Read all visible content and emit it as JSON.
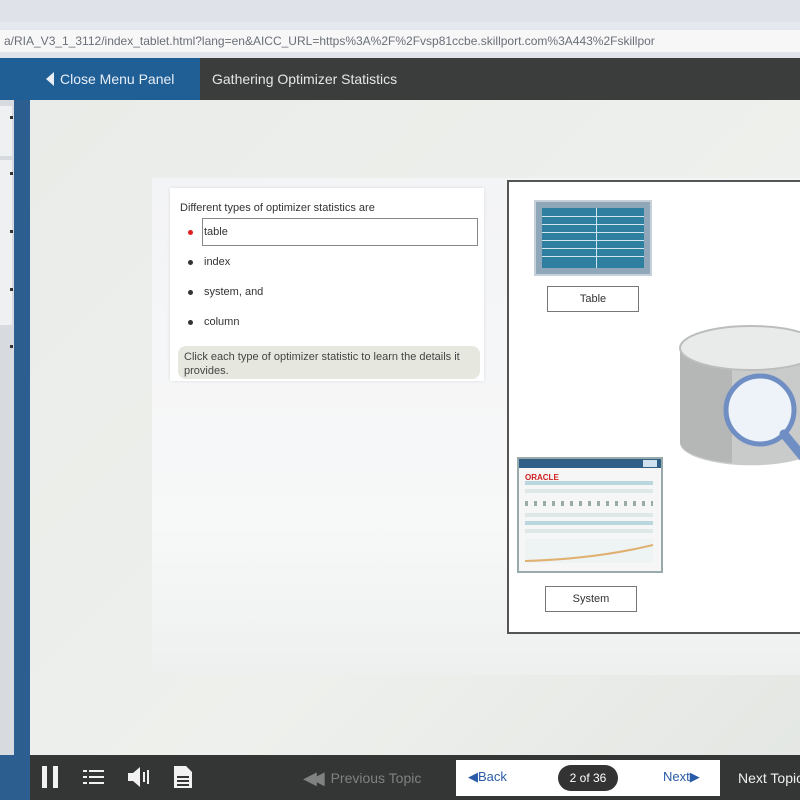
{
  "browser": {
    "url": "a/RIA_V3_1_3112/index_tablet.html?lang=en&AICC_URL=https%3A%2F%2Fvsp81ccbe.skillport.com%3A443%2Fskillpor"
  },
  "header": {
    "close_menu_label": "Close Menu Panel",
    "course_title": "Gathering Optimizer Statistics"
  },
  "lesson": {
    "intro": "Different types of optimizer statistics are",
    "items": [
      "table",
      "index",
      "system, and",
      "column"
    ],
    "hint": "Click each type of optimizer statistic to learn the details it provides."
  },
  "diagram": {
    "labels": {
      "table": "Table",
      "system": "System"
    },
    "system_logo": "ORACLE"
  },
  "toolbar": {
    "previous_topic": "Previous Topic",
    "back": "Back",
    "page_indicator": "2 of 36",
    "next": "Next",
    "next_topic": "Next Topic"
  }
}
